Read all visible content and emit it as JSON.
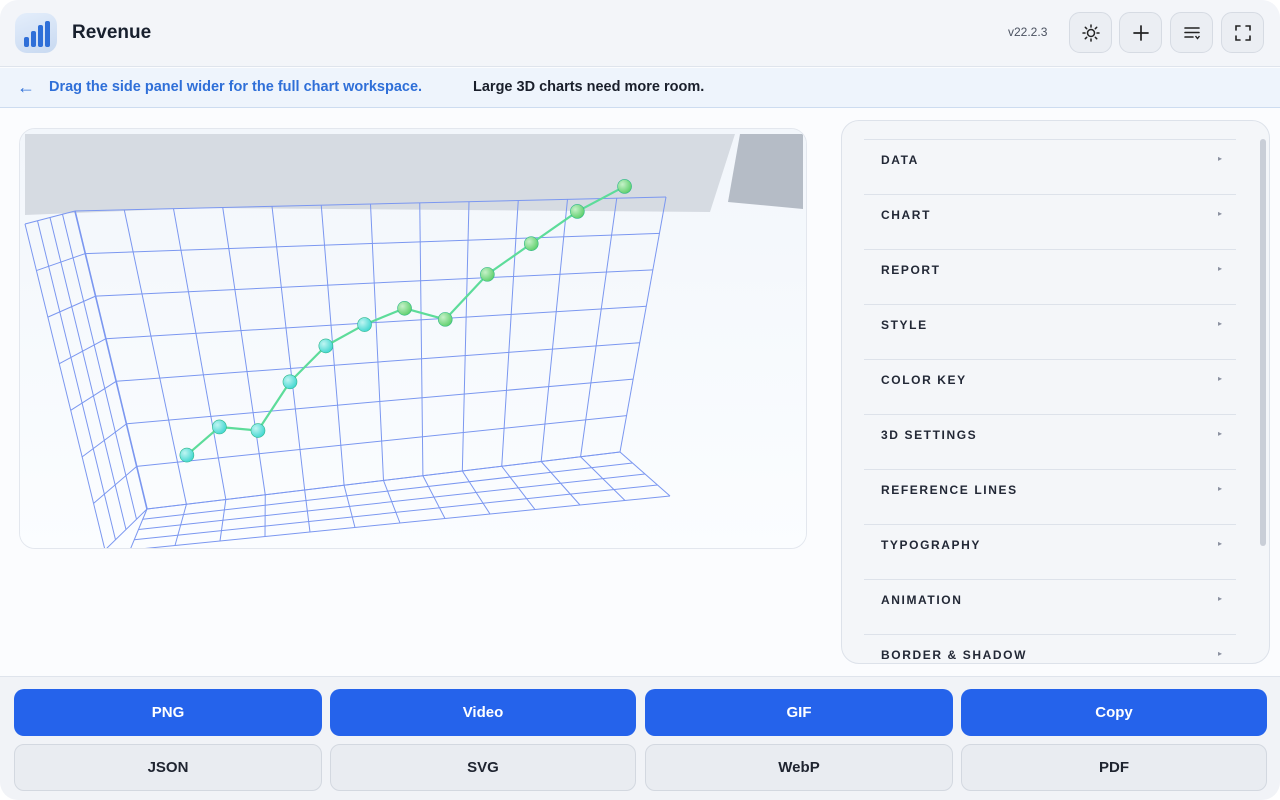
{
  "header": {
    "title": "Revenue",
    "version": "v22.2.3",
    "buttons": [
      {
        "name": "theme-toggle-button",
        "icon": "sun-icon"
      },
      {
        "name": "add-button",
        "icon": "plus-icon"
      },
      {
        "name": "menu-button",
        "icon": "list-icon"
      },
      {
        "name": "fullscreen-button",
        "icon": "expand-icon"
      }
    ]
  },
  "banner": {
    "arrow": "←",
    "link_text": "Drag the side panel wider for the full chart workspace.",
    "message": "Large 3D charts need more room."
  },
  "chart_data": {
    "type": "line",
    "title": "",
    "series": [
      {
        "values": [
          1,
          2,
          1.7,
          3.6,
          5,
          5.8,
          6.4,
          5.8,
          7.7,
          9,
          10.4,
          11.5
        ]
      }
    ],
    "colors": {
      "line": "#5ddc9a",
      "point_start": "#3fd6d0",
      "point_end": "#5ccf6a",
      "grid": "#7b97f0"
    }
  },
  "panel": {
    "items": [
      {
        "label": "DATA"
      },
      {
        "label": "CHART"
      },
      {
        "label": "REPORT"
      },
      {
        "label": "STYLE"
      },
      {
        "label": "COLOR KEY"
      },
      {
        "label": "3D SETTINGS"
      },
      {
        "label": "REFERENCE LINES"
      },
      {
        "label": "TYPOGRAPHY"
      },
      {
        "label": "ANIMATION"
      },
      {
        "label": "BORDER & SHADOW"
      }
    ],
    "caret": "▸"
  },
  "export": {
    "primary": [
      "PNG",
      "Video",
      "GIF",
      "Copy"
    ],
    "secondary": [
      "JSON",
      "SVG",
      "WebP",
      "PDF"
    ]
  }
}
